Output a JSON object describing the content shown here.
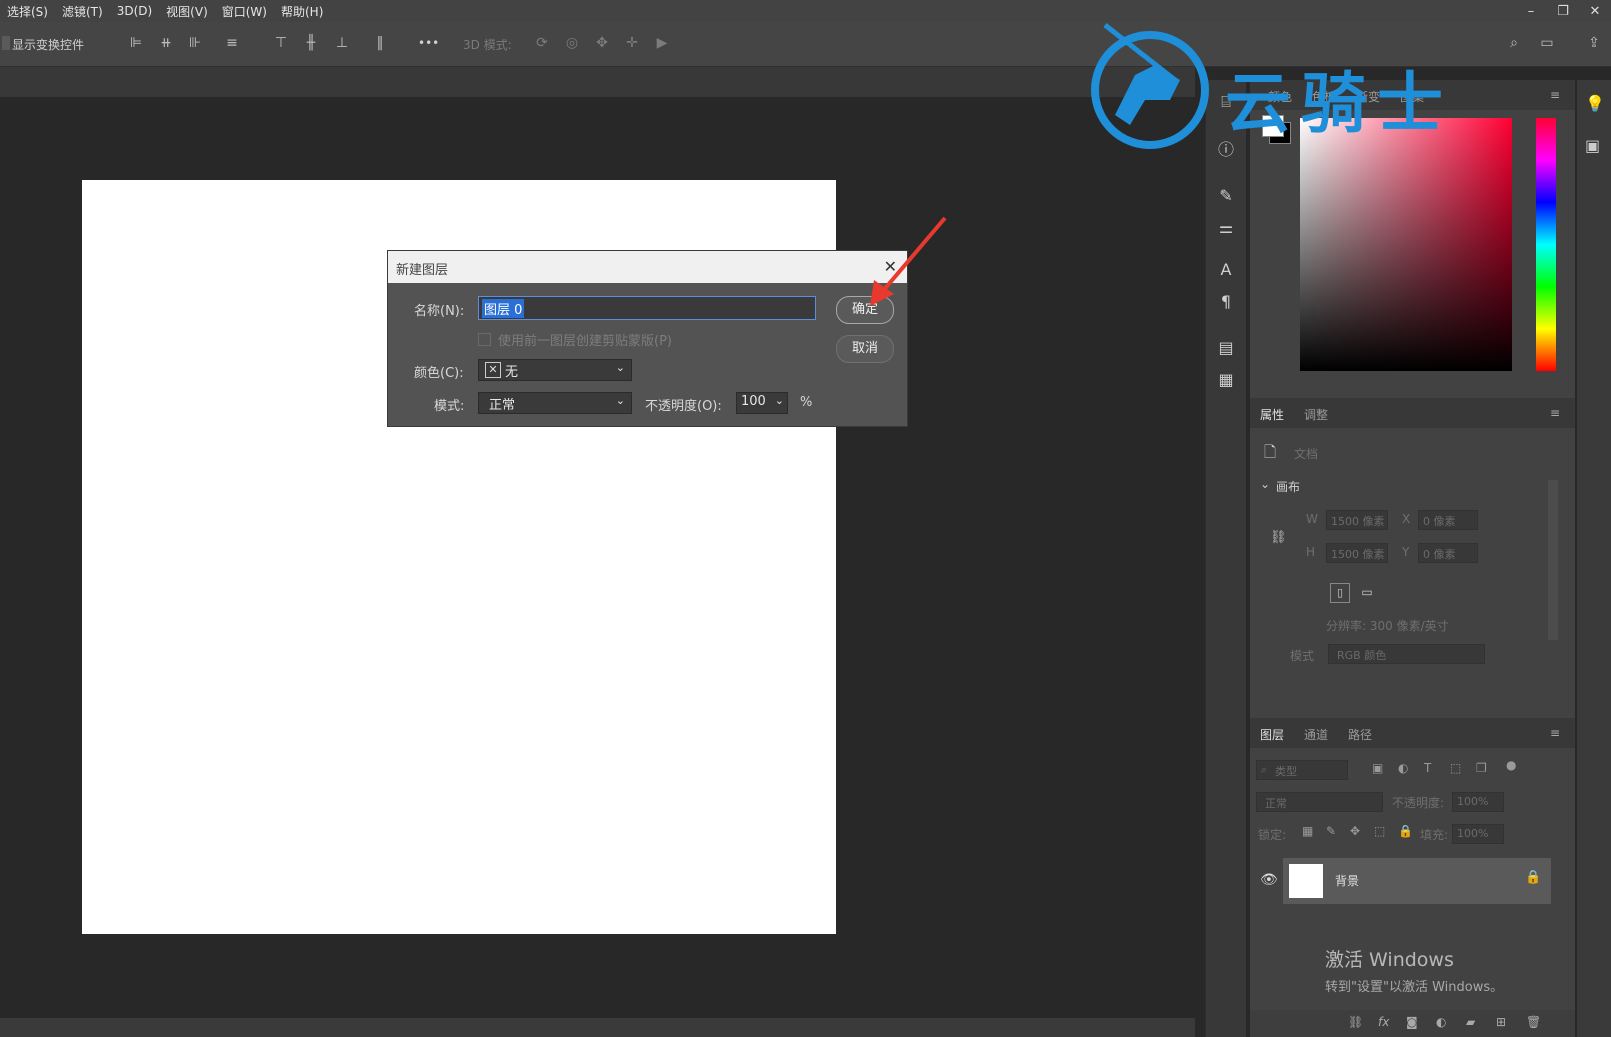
{
  "menubar": {
    "items": [
      "选择(S)",
      "滤镜(T)",
      "3D(D)",
      "视图(V)",
      "窗口(W)",
      "帮助(H)"
    ]
  },
  "window_controls": {
    "minimize": "–",
    "restore": "❐",
    "close": "✕"
  },
  "options_bar": {
    "show_transform_label": "显示变换控件",
    "more_label": "•••",
    "mode3d_label": "3D 模式:"
  },
  "dialog": {
    "title": "新建图层",
    "close": "✕",
    "name_label": "名称(N):",
    "name_value": "图层 0",
    "clip_checkbox_label": "使用前一图层创建剪贴蒙版(P)",
    "color_label": "颜色(C):",
    "color_value": "无",
    "mode_label": "模式:",
    "mode_value": "正常",
    "opacity_label": "不透明度(O):",
    "opacity_value": "100",
    "opacity_unit": "%",
    "ok_label": "确定",
    "cancel_label": "取消"
  },
  "color_panel": {
    "tabs": [
      "颜色",
      "色板",
      "渐变",
      "图案"
    ],
    "foreground": "#ffffff",
    "background": "#000000",
    "hue": "#ff0033"
  },
  "properties_panel": {
    "tabs": [
      "属性",
      "调整"
    ],
    "doc_label": "文档",
    "section": "画布",
    "w_label": "W",
    "w_value": "1500 像素",
    "x_label": "X",
    "x_value": "0 像素",
    "h_label": "H",
    "h_value": "1500 像素",
    "y_label": "Y",
    "y_value": "0 像素",
    "resolution": "分辨率: 300 像素/英寸",
    "mode_label": "模式",
    "mode_value": "RGB 颜色"
  },
  "layers_panel": {
    "tabs": [
      "图层",
      "通道",
      "路径"
    ],
    "filter_placeholder": "类型",
    "blend_value": "正常",
    "opacity_label": "不透明度:",
    "opacity_value": "100%",
    "lock_label": "锁定:",
    "fill_label": "填充:",
    "fill_value": "100%",
    "layer_name": "背景"
  },
  "watermark": {
    "text": "云骑士"
  },
  "activate_windows": {
    "line1": "激活 Windows",
    "line2": "转到\"设置\"以激活 Windows。"
  },
  "colors": {
    "accent_arrow": "#e8392f",
    "watermark_blue": "#1e8fd8",
    "selection_blue": "#2a6fd6"
  }
}
